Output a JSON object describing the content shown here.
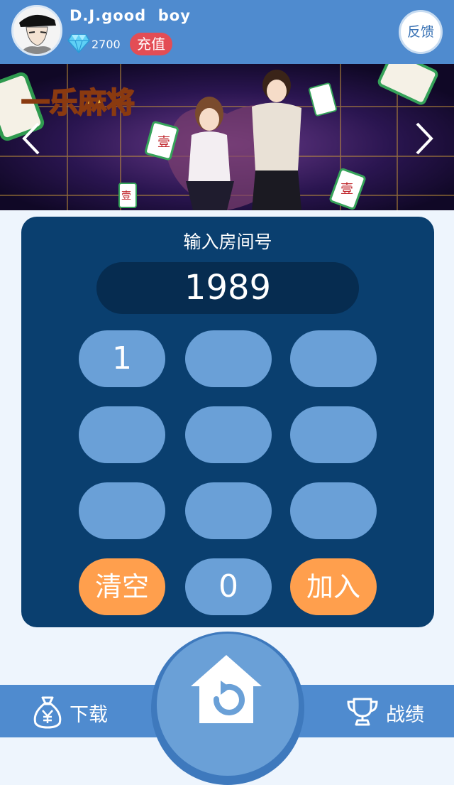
{
  "header": {
    "username": "D.J.good  boy",
    "gem_count": "2700",
    "recharge_label": "充值",
    "feedback_label": "反馈",
    "avatar_icon": "avatar-portrait-icon",
    "gem_icon": "diamond-icon"
  },
  "banner": {
    "logo_text": "一乐麻将",
    "prev_icon": "chevron-left-icon",
    "next_icon": "chevron-right-icon"
  },
  "room": {
    "title": "输入房间号",
    "value": "1989"
  },
  "keypad": {
    "rows": [
      [
        "1",
        "",
        ""
      ],
      [
        "",
        "",
        ""
      ],
      [
        "",
        "",
        ""
      ]
    ],
    "clear_label": "清空",
    "zero_label": "0",
    "join_label": "加入"
  },
  "bottom_nav": {
    "download_label": "下载",
    "record_label": "战绩",
    "download_icon": "money-bag-icon",
    "home_icon": "home-return-icon",
    "record_icon": "trophy-icon"
  },
  "colors": {
    "header_blue": "#4f8bcf",
    "panel_navy": "#0a3f6f",
    "key_blue": "#6aa0d7",
    "accent_orange": "#ff9f4d",
    "recharge_red": "#e34d55"
  }
}
